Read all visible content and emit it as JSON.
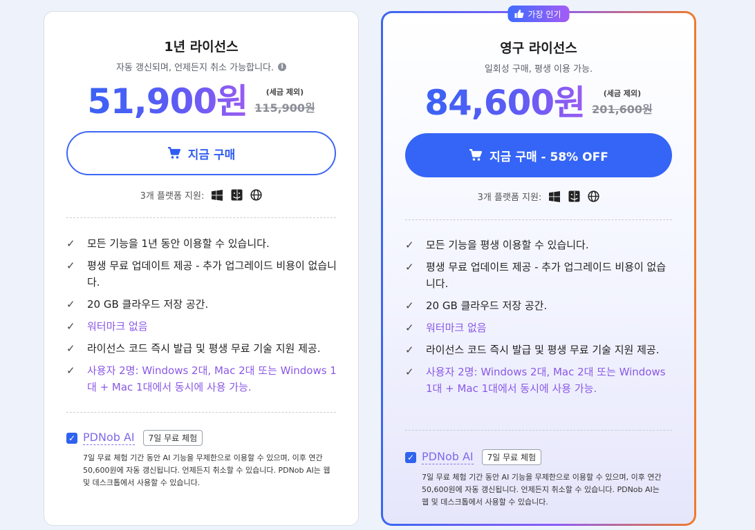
{
  "plans": [
    {
      "title": "1년 라이선스",
      "subtitle": "자동 갱신되며, 언제든지 취소 가능합니다.",
      "price": "51,900원",
      "tax_note": "(세금 제외)",
      "old_price": "115,900원",
      "button_label": "지금 구매",
      "platforms_label": "3개 플랫폼 지원:",
      "features": [
        "모든 기능을 1년 동안 이용할 수 있습니다.",
        "평생 무료 업데이트 제공 - 추가 업그레이드 비용이 없습니다.",
        "20 GB 클라우드 저장 공간.",
        "워터마크 없음",
        "라이선스 코드 즉시 발급 및 평생 무료 기술 지원 제공.",
        "사용자 2명: Windows 2대, Mac 2대 또는 Windows 1대 + Mac 1대에서 동시에 사용 가능."
      ],
      "ai_name": "PDNob AI",
      "ai_trial": "7일 무료 체험",
      "ai_desc": "7일 무료 체험 기간 동안 AI 기능을 무제한으로 이용할 수 있으며, 이후 연간 50,600원에 자동 갱신됩니다. 언제든지 취소할 수 있습니다. PDNob AI는 웹 및 데스크톱에서 사용할 수 있습니다.",
      "ai_checked": true
    },
    {
      "badge": "가장 인기",
      "title": "영구 라이선스",
      "subtitle": "일회성 구매, 평생 이용 가능.",
      "price": "84,600원",
      "tax_note": "(세금 제외)",
      "old_price": "201,600원",
      "button_label": "지금 구매 - 58% OFF",
      "platforms_label": "3개 플랫폼 지원:",
      "features": [
        "모든 기능을 평생 이용할 수 있습니다.",
        "평생 무료 업데이트 제공 - 추가 업그레이드 비용이 없습니다.",
        "20 GB 클라우드 저장 공간.",
        "워터마크 없음",
        "라이선스 코드 즉시 발급 및 평생 무료 기술 지원 제공.",
        "사용자 2명: Windows 2대, Mac 2대 또는 Windows 1대 + Mac 1대에서 동시에 사용 가능."
      ],
      "ai_name": "PDNob AI",
      "ai_trial": "7일 무료 체험",
      "ai_desc": "7일 무료 체험 기간 동안 AI 기능을 무제한으로 이용할 수 있으며, 이후 연간 50,600원에 자동 갱신됩니다. 언제든지 취소할 수 있습니다. PDNob AI는 웹 및 데스크톱에서 사용할 수 있습니다.",
      "ai_checked": true
    }
  ],
  "icons": {
    "badge": "thumbs-up-icon",
    "button": "cart-icon",
    "info": "info-icon",
    "check": "check-icon",
    "platforms": [
      "windows-icon",
      "mac-finder-icon",
      "globe-icon"
    ]
  },
  "colors": {
    "accent": "#3565f6",
    "purple_text": "#8a58e6",
    "badge_gradient": [
      "#3f6bff",
      "#a35cf4"
    ]
  }
}
